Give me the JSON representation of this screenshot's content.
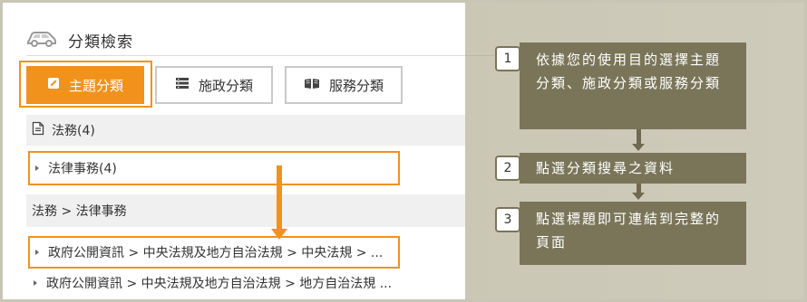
{
  "header": {
    "title": "分類檢索",
    "icon": "car-icon"
  },
  "tabs": [
    {
      "label": "主題分類",
      "icon": "edit-icon",
      "active": true
    },
    {
      "label": "施政分類",
      "icon": "list-icon",
      "active": false
    },
    {
      "label": "服務分類",
      "icon": "book-icon",
      "active": false
    }
  ],
  "section": {
    "label": "法務(4)",
    "icon": "document-icon"
  },
  "category_item": "法律事務(4)",
  "path": "法務 > 法律事務",
  "results": [
    "政府公開資訊 > 中央法規及地方自治法規 > 中央法規 > ...",
    "政府公開資訊 > 中央法規及地方自治法規 > 地方自治法規 ..."
  ],
  "steps": [
    {
      "num": "1",
      "text": "依據您的使用目的選擇主題分類、施政分類或服務分類"
    },
    {
      "num": "2",
      "text": "點選分類搜尋之資料"
    },
    {
      "num": "3",
      "text": "點選標題即可連結到完整的頁面"
    }
  ],
  "colors": {
    "accent": "#f0921c",
    "step_bg": "#7a7559",
    "panel_bg": "#cdc9b8"
  }
}
